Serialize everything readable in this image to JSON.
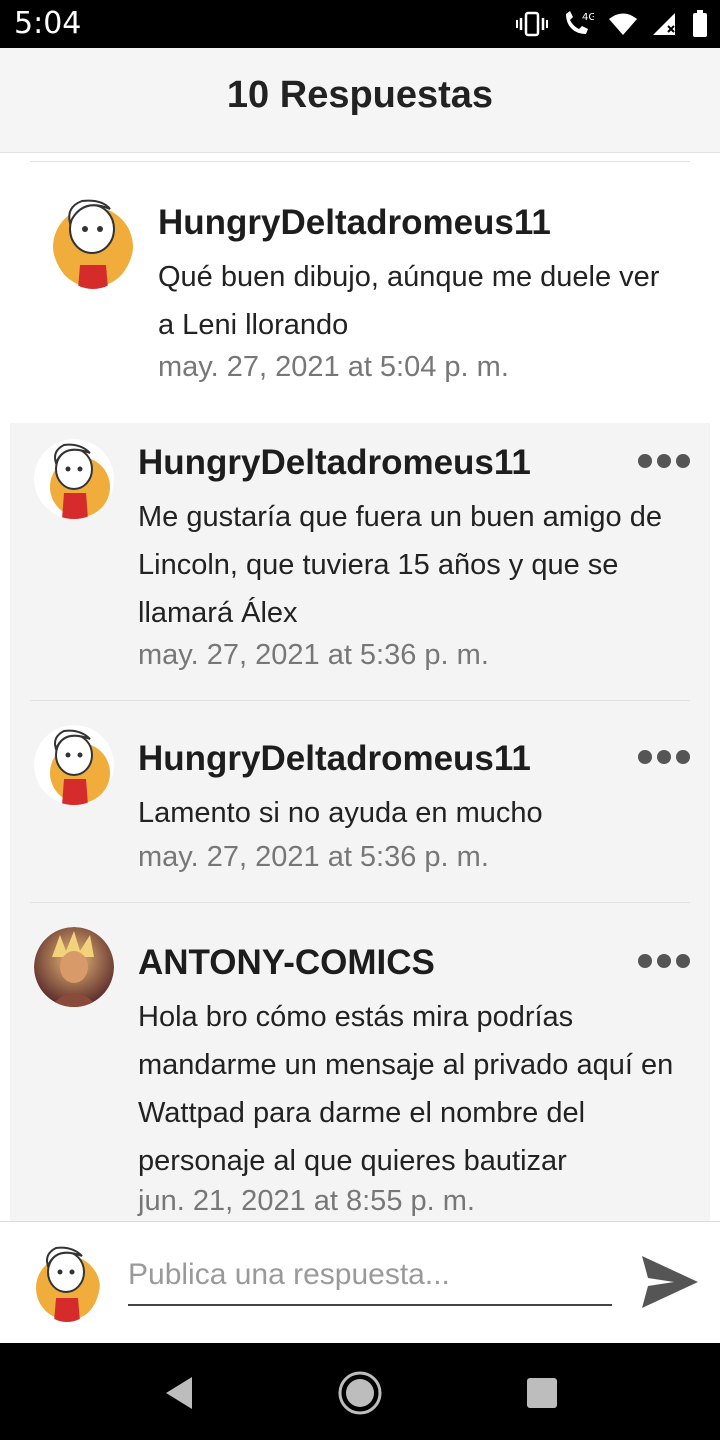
{
  "status_bar": {
    "time": "5:04",
    "network": "4G"
  },
  "header": {
    "title": "10 Respuestas"
  },
  "comments": [
    {
      "username": "HungryDeltadromeus11",
      "text": "Qué buen dibujo, aúnque me duele ver a Leni llorando",
      "time": "may. 27, 2021 at 5:04 p. m."
    },
    {
      "username": "HungryDeltadromeus11",
      "text": "Me gustaría que fuera un buen amigo de Lincoln, que tuviera 15 años y que se llamará Álex",
      "time": "may. 27, 2021 at 5:36 p. m."
    },
    {
      "username": "HungryDeltadromeus11",
      "text": "Lamento si no ayuda en mucho",
      "time": "may. 27, 2021 at 5:36 p. m."
    },
    {
      "username": "ANTONY-COMICS",
      "text": "Hola bro cómo estás mira podrías mandarme un mensaje al privado aquí en Wattpad para darme el nombre del personaje al que quieres bautizar",
      "time": "jun. 21, 2021 at 8:55 p. m."
    }
  ],
  "compose": {
    "placeholder": "Publica una respuesta..."
  },
  "colors": {
    "status_bar": "#000000",
    "header_bg": "#f5f5f5",
    "reply_bg": "#f4f4f4",
    "muted_text": "#777777"
  }
}
